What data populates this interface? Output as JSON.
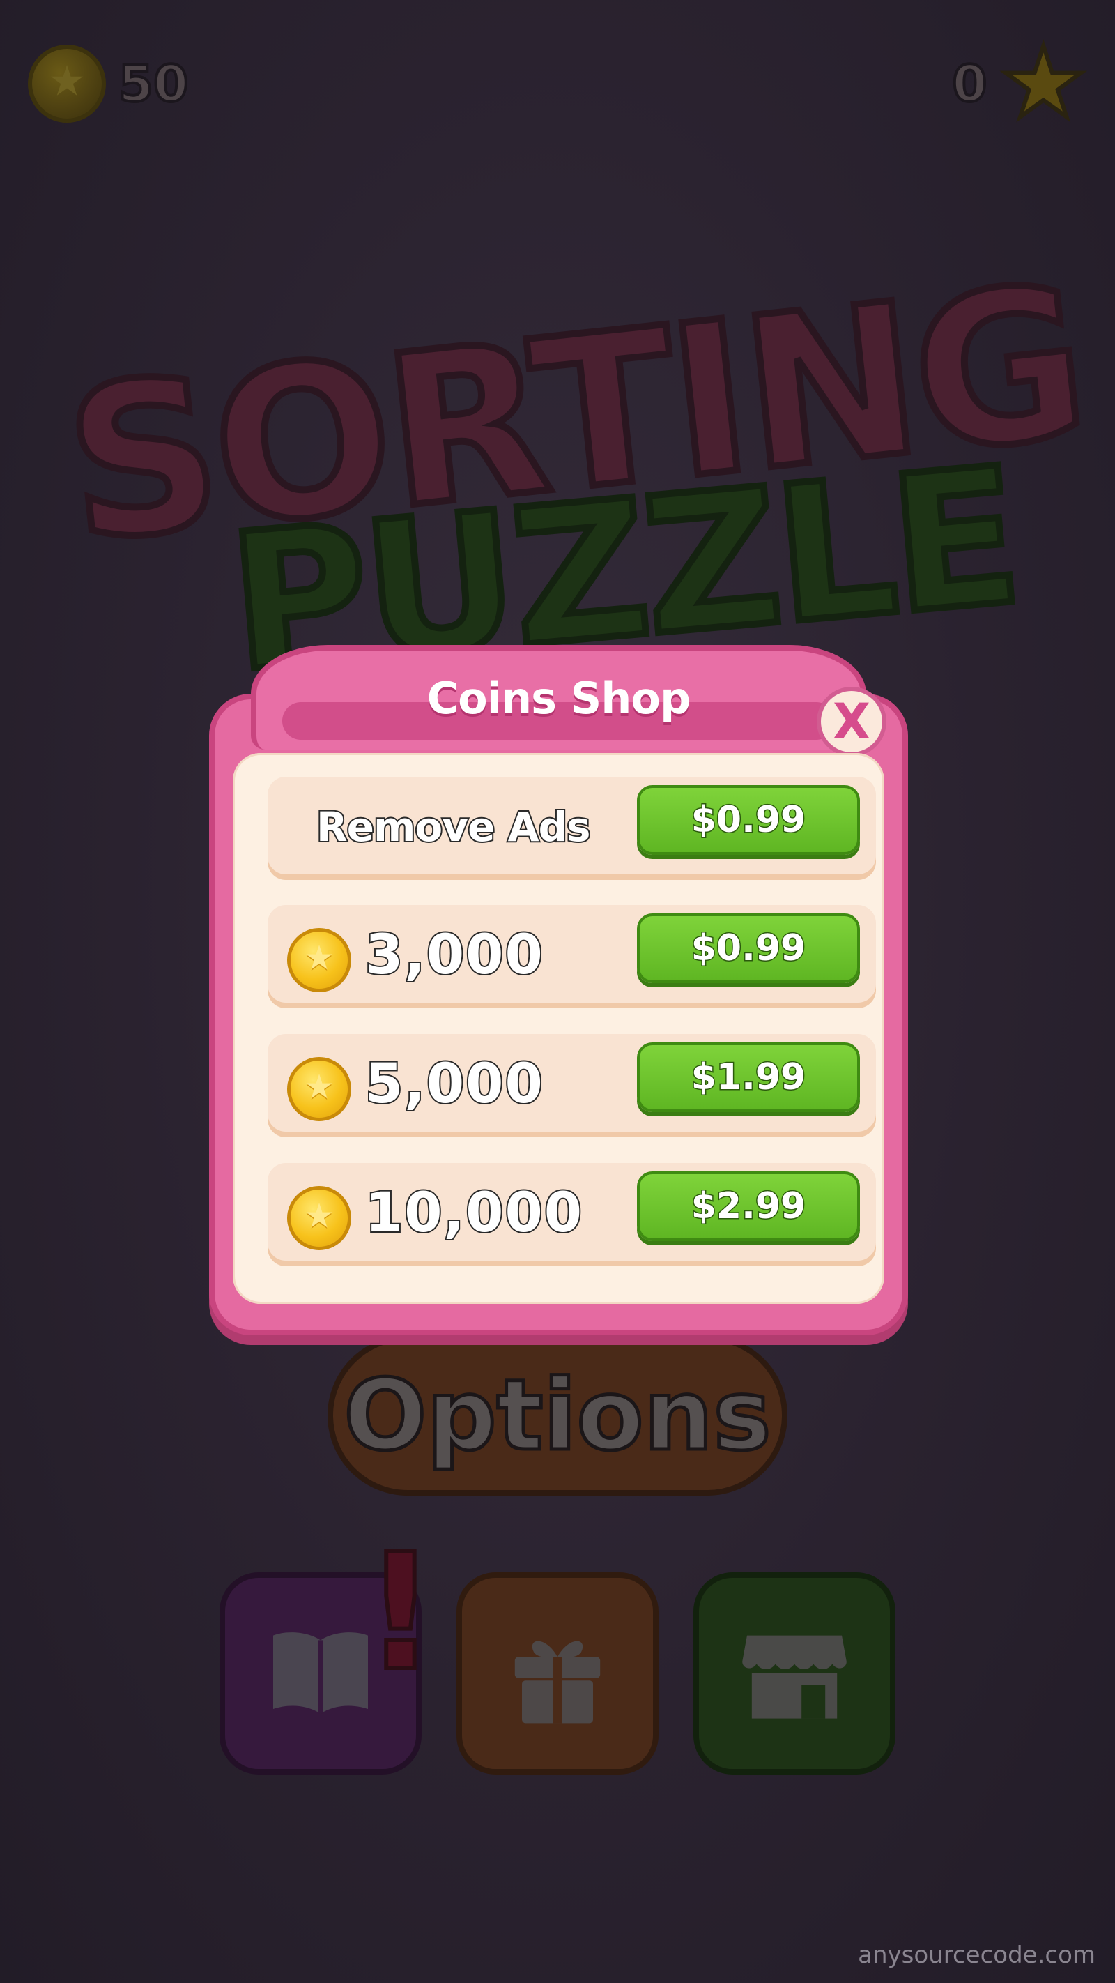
{
  "hud": {
    "coins": "50",
    "stars": "0",
    "coin_icon": "coin-icon",
    "star_icon": "star-icon"
  },
  "logo": {
    "line1": "SORTING",
    "line2": "PUZZLE"
  },
  "menu": {
    "options_label": "Options",
    "notification_mark": "!"
  },
  "shop": {
    "title": "Coins Shop",
    "close_label": "X",
    "items": [
      {
        "label": "Remove Ads",
        "price": "$0.99",
        "icon": "none"
      },
      {
        "label": "3,000",
        "price": "$0.99",
        "icon": "coin-icon"
      },
      {
        "label": "5,000",
        "price": "$1.99",
        "icon": "coin-icon"
      },
      {
        "label": "10,000",
        "price": "$2.99",
        "icon": "coin-icon"
      }
    ]
  },
  "watermark": "anysourcecode.com",
  "colors": {
    "dialog_pink": "#e56aa1",
    "price_green": "#5fb623",
    "coin_gold": "#f7c21b"
  }
}
